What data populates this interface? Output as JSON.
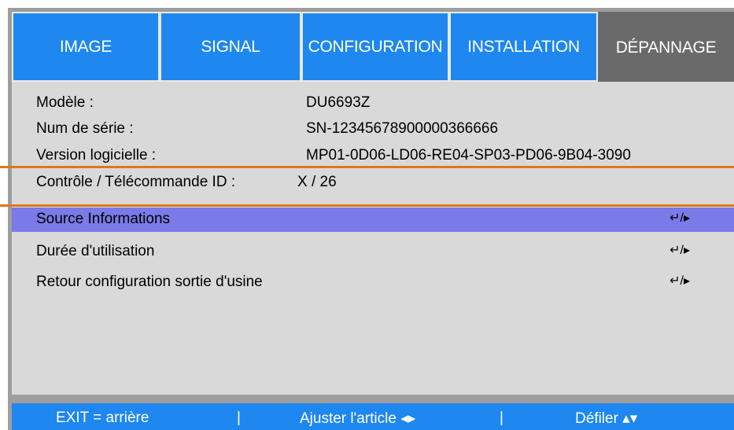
{
  "tabs": [
    {
      "label": "IMAGE"
    },
    {
      "label": "SIGNAL"
    },
    {
      "label": "CONFIGURATION"
    },
    {
      "label": "INSTALLATION"
    },
    {
      "label": "DÉPANNAGE",
      "active": true
    }
  ],
  "info": {
    "model_label": "Modèle :",
    "model_value": "DU6693Z",
    "serial_label": "Num de série :",
    "serial_value": "SN-12345678900000366666",
    "version_label": "Version logicielle :",
    "version_value": "MP01-0D06-LD06-RE04-SP03-PD06-9B04-3090",
    "control_label": "Contrôle / Télécommande ID :",
    "control_value": "X / 26"
  },
  "menu": [
    {
      "label": "Source Informations",
      "indicator": "↵/▸",
      "selected": true
    },
    {
      "label": "Durée d'utilisation",
      "indicator": "↵/▸"
    },
    {
      "label": "Retour configuration sortie d'usine",
      "indicator": "↵/▸"
    }
  ],
  "footer": {
    "exit": "EXIT = arrière",
    "sep1": "|",
    "adjust": "Ajuster l'article ◂▸",
    "sep2": "|",
    "scroll": "Défiler ▴▾"
  },
  "colors": {
    "tab_blue": "#1e87f0",
    "tab_active": "#6a6a6a",
    "panel": "#d9d9d9",
    "selected_row": "#7a7ae8",
    "highlight_outline": "#e07814"
  }
}
